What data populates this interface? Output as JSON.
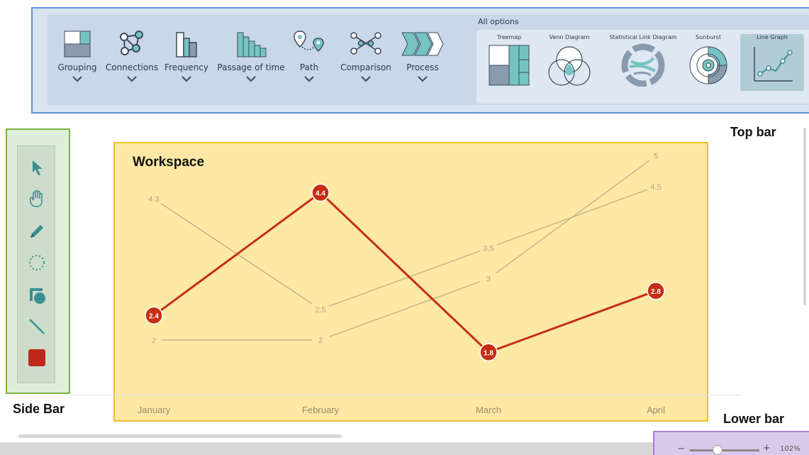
{
  "top_bar": {
    "categories": [
      {
        "label": "Grouping",
        "icon": "grouping-icon"
      },
      {
        "label": "Connections",
        "icon": "connections-icon"
      },
      {
        "label": "Frequency",
        "icon": "frequency-icon"
      },
      {
        "label": "Passage of time",
        "icon": "passage-of-time-icon"
      },
      {
        "label": "Path",
        "icon": "path-icon"
      },
      {
        "label": "Comparison",
        "icon": "comparison-icon"
      },
      {
        "label": "Process",
        "icon": "process-icon"
      }
    ],
    "all_options_title": "All options",
    "options": [
      {
        "label": "Treemap",
        "icon": "treemap-icon"
      },
      {
        "label": "Venn Diagram",
        "icon": "venn-diagram-icon"
      },
      {
        "label": "Statistical Link Diagram",
        "icon": "statistical-link-diagram-icon"
      },
      {
        "label": "Sunburst",
        "icon": "sunburst-icon"
      },
      {
        "label": "Line Graph",
        "icon": "line-graph-icon",
        "selected": true
      }
    ],
    "colors": {
      "icon_teal": "#76c3c3",
      "icon_slate": "#8a9bb0",
      "icon_dark": "#3c4a5c",
      "panel": "#c9d7e7",
      "border": "#5b8fd6"
    }
  },
  "side_bar": {
    "tools": [
      {
        "icon": "pointer-icon"
      },
      {
        "icon": "hand-icon"
      },
      {
        "icon": "pencil-icon"
      },
      {
        "icon": "lasso-icon"
      },
      {
        "icon": "shape-icon"
      },
      {
        "icon": "line-icon"
      },
      {
        "icon": "color-swatch-icon",
        "color": "#c0281b"
      }
    ]
  },
  "workspace": {
    "title": "Workspace"
  },
  "region_labels": {
    "top": "Top bar",
    "side": "Side Bar",
    "lower": "Lower bar"
  },
  "lower_bar": {
    "zoom_minus": "−",
    "zoom_plus": "+",
    "zoom_value": "102%",
    "zoom_level_fraction": 0.4
  },
  "chart_data": {
    "type": "line",
    "categories": [
      "January",
      "February",
      "March",
      "April"
    ],
    "series": [
      {
        "values": [
          2.4,
          4.4,
          1.8,
          2.8
        ],
        "color": "#c52e12",
        "highlight": true
      },
      {
        "values": [
          4.3,
          2.5,
          3.5,
          4.5
        ],
        "color": "#c9b488"
      },
      {
        "values": [
          2,
          2,
          3,
          5
        ],
        "color": "#c9b488"
      }
    ]
  }
}
